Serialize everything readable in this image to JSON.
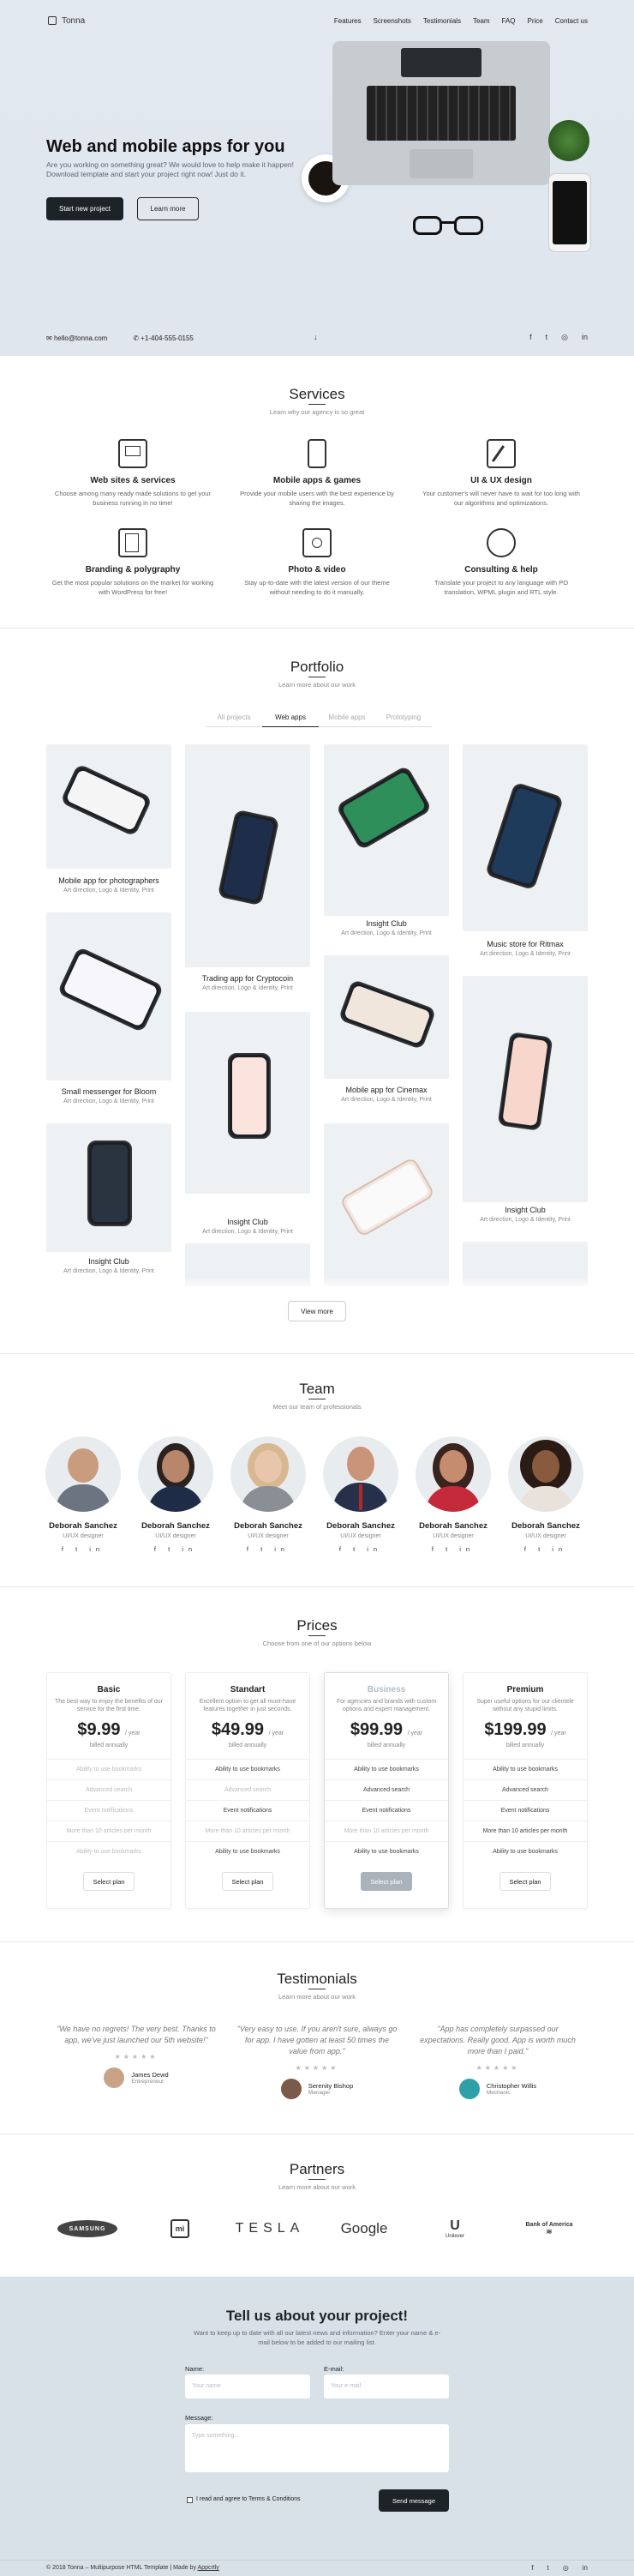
{
  "nav": {
    "brand": "Tonna",
    "links": [
      "Features",
      "Screenshots",
      "Testimonials",
      "Team",
      "FAQ",
      "Price",
      "Contact us"
    ]
  },
  "hero": {
    "title": "Web and mobile apps for you",
    "subtitle": "Are you working on something great? We would love to help make it happen! Download template and start your project right now! Just do it.",
    "primary_button": "Start new project",
    "secondary_button": "Learn more",
    "email": "hello@tonna.com",
    "phone": "+1-404-555-0155"
  },
  "services": {
    "title": "Services",
    "subtitle": "Learn why our agency is so great",
    "items": [
      {
        "title": "Web sites & services",
        "text": "Choose among many ready made solutions to get your business running in no time!",
        "icon": "monitor-icon"
      },
      {
        "title": "Mobile apps & games",
        "text": "Provide your mobile users with the best experience by sharing the images.",
        "icon": "mobile-icon"
      },
      {
        "title": "UI & UX design",
        "text": "Your customer's will never have to wait for too long with our algorithms and optimizations.",
        "icon": "design-icon"
      },
      {
        "title": "Branding & polygraphy",
        "text": "Get the most popular solutions on the market for working with WordPress for free!",
        "icon": "branding-icon"
      },
      {
        "title": "Photo & video",
        "text": "Stay up-to-date with the latest version of our theme without needing to do it manually.",
        "icon": "camera-icon"
      },
      {
        "title": "Consulting & help",
        "text": "Translate your project to any language with PO translation, WPML plugin and RTL style.",
        "icon": "consulting-icon"
      }
    ]
  },
  "portfolio": {
    "title": "Portfolio",
    "subtitle": "Learn more about our work",
    "tabs": [
      "All projects",
      "Web apps",
      "Mobile apps",
      "Prototyping"
    ],
    "active_tab": "Web apps",
    "items": [
      {
        "title": "Mobile app for photographers",
        "desc": "Art direction, Logo & Identity, Print"
      },
      {
        "title": "Small messenger for Bloom",
        "desc": "Art direction, Logo & Identity, Print"
      },
      {
        "title": "Insight Club",
        "desc": "Art direction, Logo & Identity, Print"
      },
      {
        "title": "Trading app for Cryptocoin",
        "desc": "Art direction, Logo & Identity, Print"
      },
      {
        "title": "Insight Club",
        "desc": "Art direction, Logo & Identity, Print"
      },
      {
        "title": "Insight Club",
        "desc": "Art direction, Logo & Identity, Print"
      },
      {
        "title": "Mobile app for Cinemax",
        "desc": "Art direction, Logo & Identity, Print"
      },
      {
        "title": "Music store for Ritmax",
        "desc": "Art direction, Logo & Identity, Print"
      },
      {
        "title": "Insight Club",
        "desc": "Art direction, Logo & Identity, Print"
      }
    ],
    "view_more": "View more"
  },
  "team": {
    "title": "Team",
    "subtitle": "Meet our team of professionals",
    "members": [
      {
        "name": "Deborah Sanchez",
        "role": "UI/UX designer"
      },
      {
        "name": "Deborah Sanchez",
        "role": "UI/UX designer"
      },
      {
        "name": "Deborah Sanchez",
        "role": "UI/UX designer"
      },
      {
        "name": "Deborah Sanchez",
        "role": "UI/UX designer"
      },
      {
        "name": "Deborah Sanchez",
        "role": "UI/UX designer"
      },
      {
        "name": "Deborah Sanchez",
        "role": "UI/UX designer"
      }
    ],
    "social": "f t in"
  },
  "prices": {
    "title": "Prices",
    "subtitle": "Choose from one of our options below",
    "plans": [
      {
        "name": "Basic",
        "desc": "The best way to enjoy the benefits of our service for the first time.",
        "price": "$9.99",
        "period": "/ year",
        "billing": "billed annually",
        "features": [
          "Ability to use bookmarks",
          "Advanced search",
          "Event notifications",
          "More than 10 articles per month",
          "Ability to use bookmarks"
        ],
        "button": "Select plan"
      },
      {
        "name": "Standart",
        "desc": "Excellent option to get all must-have features together in just seconds.",
        "price": "$49.99",
        "period": "/ year",
        "billing": "billed annually",
        "features": [
          "Ability to use bookmarks",
          "Advanced search",
          "Event notifications",
          "More than 10 articles per month",
          "Ability to use bookmarks"
        ],
        "button": "Select plan"
      },
      {
        "name": "Business",
        "desc": "For agencies and brands with custom options and expert management.",
        "price": "$99.99",
        "period": "/ year",
        "billing": "billed annually",
        "features": [
          "Ability to use bookmarks",
          "Advanced search",
          "Event notifications",
          "More than 10 articles per month",
          "Ability to use bookmarks"
        ],
        "button": "Select plan"
      },
      {
        "name": "Premium",
        "desc": "Super useful options for our clientele without any stupid limits.",
        "price": "$199.99",
        "period": "/ year",
        "billing": "billed annually",
        "features": [
          "Ability to use bookmarks",
          "Advanced search",
          "Event notifications",
          "More than 10 articles per month",
          "Ability to use bookmarks"
        ],
        "button": "Select plan"
      }
    ]
  },
  "testimonials": {
    "title": "Testimonials",
    "subtitle": "Learn more about our work",
    "items": [
      {
        "quote": "\"We have no regrets! The very best. Thanks to app, we've just launched our 5th website!\"",
        "name": "James Dewd",
        "role": "Entrepreneur"
      },
      {
        "quote": "\"Very easy to use. If you aren't sure, always go for app. I have gotten at least 50 times the value from app.\"",
        "name": "Serenity Bishop",
        "role": "Manager"
      },
      {
        "quote": "\"App has completely surpassed our expectations. Really good. App is worth much more than I paid.\"",
        "name": "Christopher Willis",
        "role": "Mechanic"
      }
    ],
    "stars": "★★★★★"
  },
  "partners": {
    "title": "Partners",
    "subtitle": "Learn more about our work",
    "logos": [
      "SAMSUNG",
      "mi",
      "TESLA",
      "Google",
      "Unilever",
      "Bank of America"
    ]
  },
  "contact": {
    "title": "Tell us about your project!",
    "subtitle": "Want to keep up to date with all our latest news and information? Enter your name & e-mail below to be added to our mailing list.",
    "name_label": "Name:",
    "name_placeholder": "Your name",
    "email_label": "E-mail:",
    "email_placeholder": "Your e-mail",
    "message_label": "Message:",
    "message_placeholder": "Type something...",
    "agree": "I read and agree to Terms & Conditions",
    "send": "Send message"
  },
  "footer": {
    "copyright": "© 2018 Tonna – Multipurpose HTML Template | Made by",
    "author": "Appcrtly"
  },
  "colors": {
    "dark": "#1d2428",
    "hero_bg": "#e2e8f0",
    "form_bg": "#d8e0e8"
  }
}
